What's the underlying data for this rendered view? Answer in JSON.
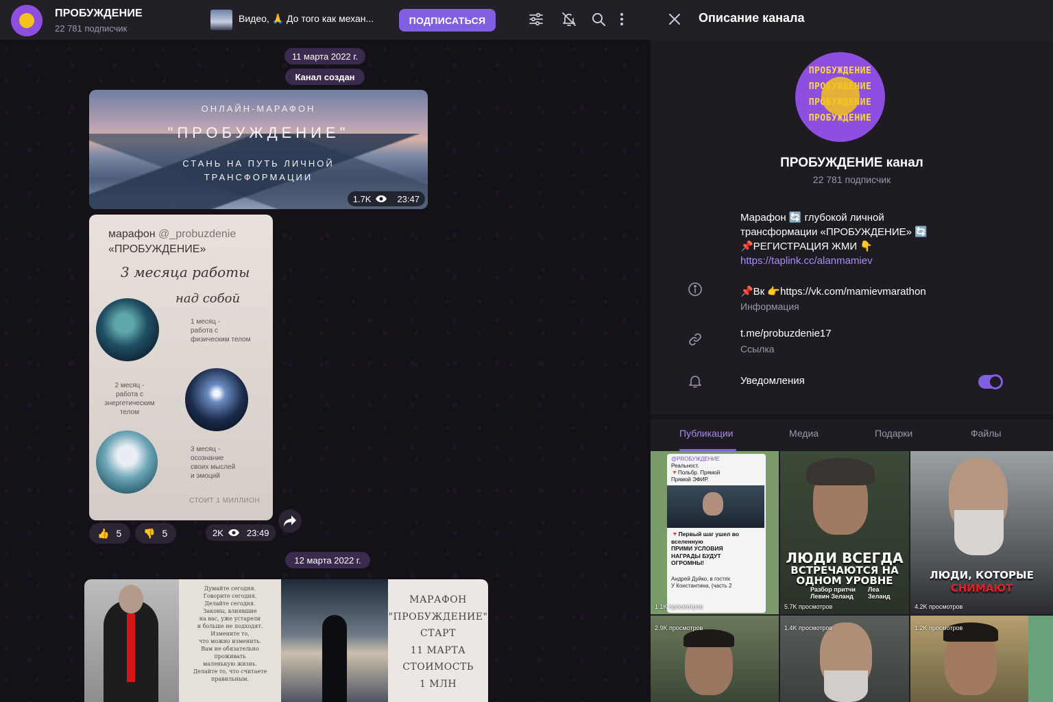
{
  "header": {
    "channel_name": "ПРОБУЖДЕНИЕ",
    "subscribers": "22 781 подписчик",
    "pinned_text": "Видео, 🙏 До того как механ...",
    "subscribe_label": "ПОДПИСАТЬСЯ",
    "icons": [
      "filter-icon",
      "mute-bell-icon",
      "search-icon",
      "more-icon"
    ]
  },
  "chat": {
    "date1": "11 марта 2022 г.",
    "service": "Канал создан",
    "post1": {
      "line1": "ОНЛАЙН-МАРАФОН",
      "line2": "\"ПРОБУЖДЕНИЕ\"",
      "line3a": "СТАНЬ НА ПУТЬ ЛИЧНОЙ",
      "line3b": "ТРАНСФОРМАЦИИ",
      "views": "1.7K",
      "time": "23:47"
    },
    "post2": {
      "title_a": "марафон ",
      "title_handle": "@_probuzdenie",
      "title_b": "«ПРОБУЖДЕНИЕ»",
      "script1": "3 месяца работы",
      "script2": "над собой",
      "m1": [
        "1 месяц -",
        "работа с",
        "физическим телом"
      ],
      "m2": [
        "2 месяц -",
        "работа с",
        "энергетическим",
        "телом"
      ],
      "m3": [
        "3 месяц -",
        "осознание",
        "своих мыслей",
        "и эмоций"
      ],
      "price": "СТОИТ 1 МИЛЛИОН",
      "like_count": "5",
      "dislike_count": "5",
      "views": "2K",
      "time": "23:49"
    },
    "date2": "12 марта 2022 г.",
    "post3": {
      "poem": [
        "Думайте сегодня.",
        "Говорите сегодня.",
        "Делайте сегодня.",
        "Законы, влиявшие",
        "на вас, уже устарели",
        "и больше не подходят.",
        "Измените то,",
        "что можно изменить.",
        "Вам не обязательно",
        "проживать",
        "маленькую жизнь.",
        "Делайте то, что считаете",
        "правильным."
      ],
      "promo": [
        "МАРАФОН",
        "\"ПРОБУЖДЕНИЕ\"",
        "СТАРТ",
        "11 МАРТА",
        "СТОИМОСТЬ",
        "1 МЛН"
      ]
    }
  },
  "sidebar": {
    "title": "Описание канала",
    "avatar_rows": [
      "ПРОБУЖДЕНИЕ",
      "ПРОБУЖДЕНИЕ",
      "ПРОБУЖДЕНИЕ",
      "ПРОБУЖДЕНИЕ"
    ],
    "name": "ПРОБУЖДЕНИЕ канал",
    "subscribers": "22 781 подписчик",
    "description": {
      "l1": "Марафон 🔄 глубокой личной",
      "l2": "трансформации «ПРОБУЖДЕНИЕ» 🔄",
      "l3": "📌РЕГИСТРАЦИЯ ЖМИ 👇",
      "link": "https://taplink.cc/alanmamiev"
    },
    "info": {
      "vk": "📌Вк 👉https://vk.com/mamievmarathon",
      "vk_label": "Информация",
      "link": "t.me/probuzdenie17",
      "link_label": "Ссылка",
      "notifications": "Уведомления",
      "notifications_on": true
    },
    "tabs": [
      "Публикации",
      "Медиа",
      "Подарки",
      "Файлы"
    ],
    "active_tab": "Публикации",
    "grid": [
      {
        "views": "1.1K просмотров",
        "lines": [
          "@РROБУЖДЕНИЕ",
          "Реальност.",
          "🔻Польбр. Прямой",
          "Прямой ЭФИР."
        ],
        "caption": [
          "🔻Первый шаг ушел во",
          "вселенную",
          "ПРИМИ УСЛОВИЯ",
          "НАГРАДЫ БУДУТ",
          "ОГРОМНЫ!"
        ],
        "footer": [
          "Андрей Дуйко, в гостях",
          "У Константина, (часть 2"
        ]
      },
      {
        "views": "5.7K просмотров",
        "caption": [
          "ЛЮДИ ВСЕГДА",
          "ВСТРЕЧАЮТСЯ НА",
          "ОДНОМ УРОВНЕ"
        ],
        "sub": [
          "Разбор притчи",
          "Леа",
          "Левин Зеланд",
          "Зеланд"
        ]
      },
      {
        "views": "4.2K просмотров",
        "caption": [
          "ЛЮДИ, КОТОРЫЕ"
        ],
        "caption_red": "СНИМАЮТ"
      },
      {
        "views": "2.9K просмотров"
      },
      {
        "views": "1.4K просмотров"
      },
      {
        "views": "1.2K просмотров"
      }
    ]
  }
}
